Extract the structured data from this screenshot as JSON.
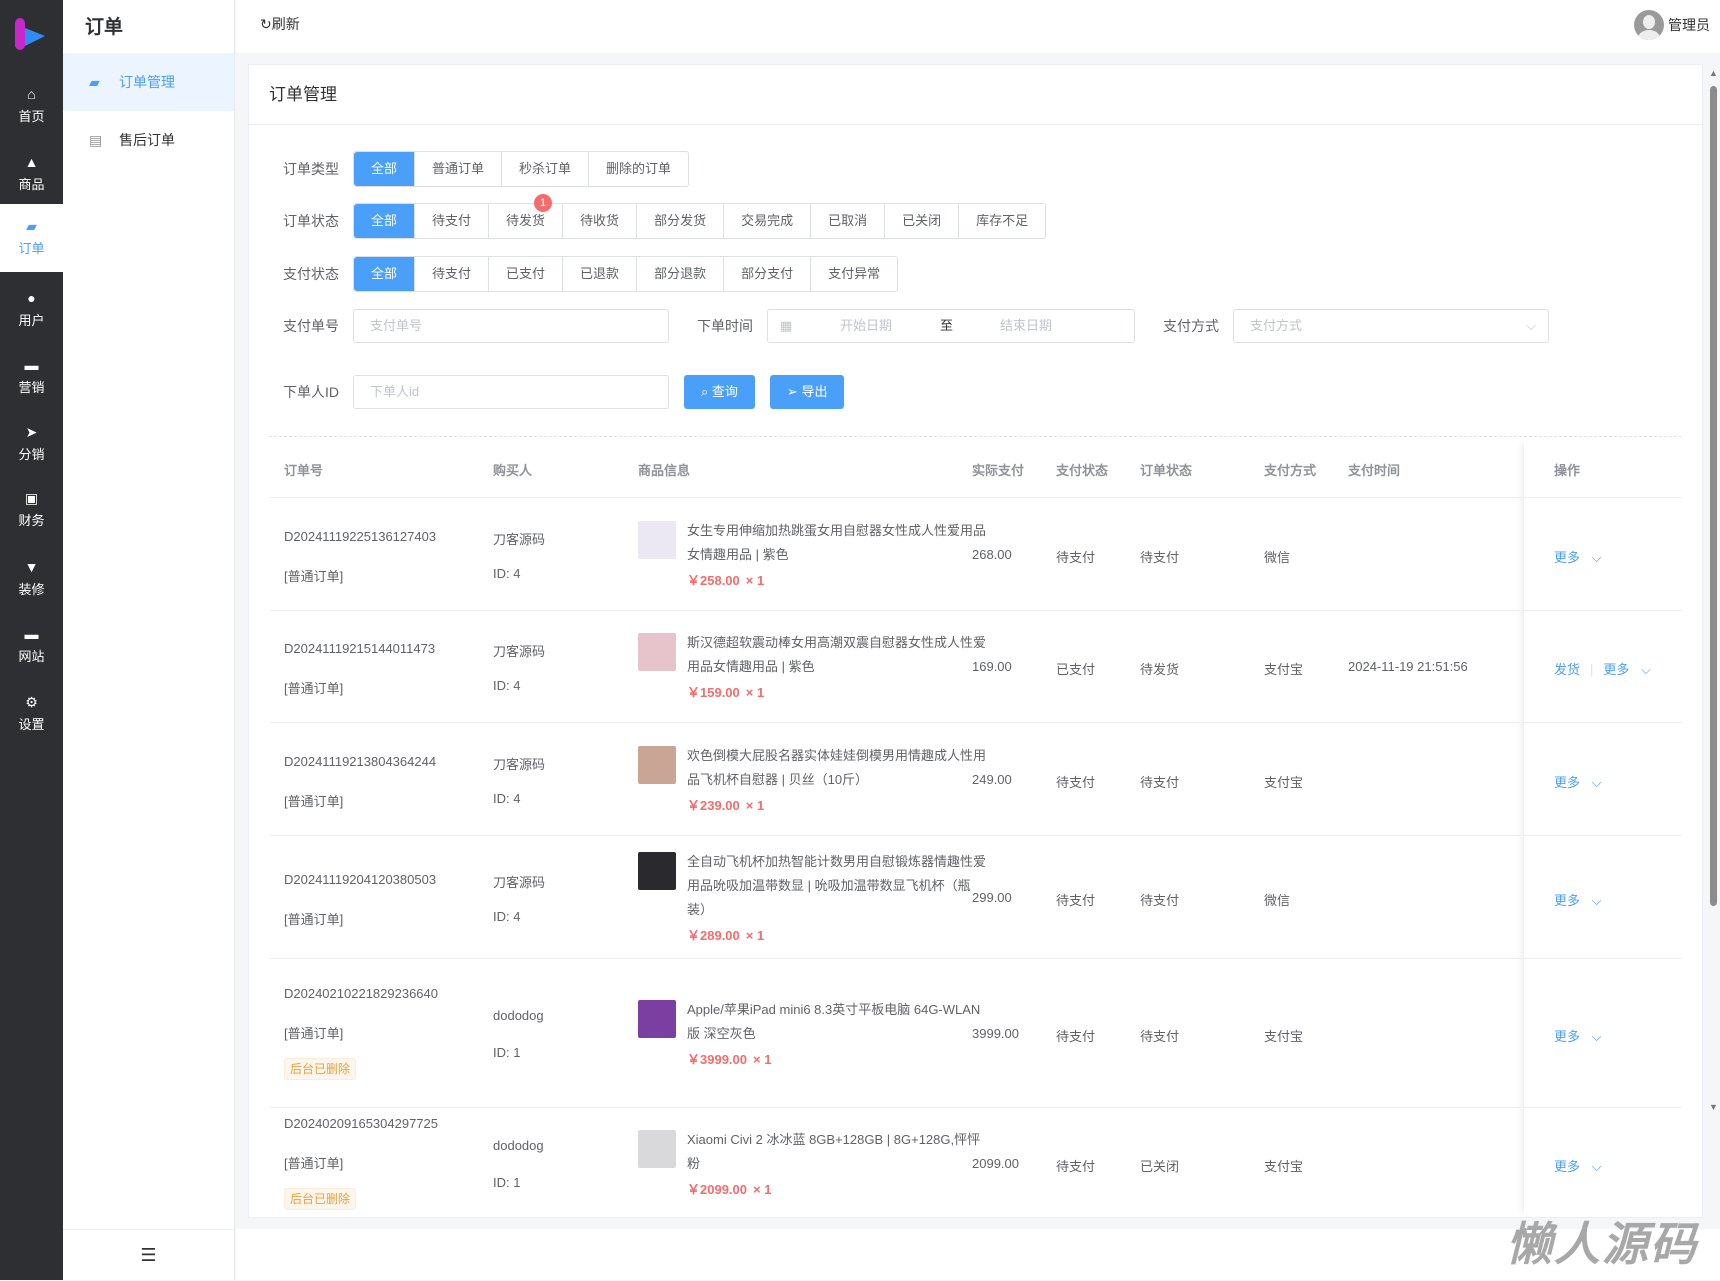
{
  "rail": {
    "items": [
      {
        "label": "首页",
        "icon": "home-icon",
        "glyph": "⌂"
      },
      {
        "label": "商品",
        "icon": "bag-icon",
        "glyph": "▲"
      },
      {
        "label": "订单",
        "icon": "wallet-icon",
        "glyph": "▰"
      },
      {
        "label": "用户",
        "icon": "user-icon",
        "glyph": "●"
      },
      {
        "label": "营销",
        "icon": "ticket-icon",
        "glyph": "▬"
      },
      {
        "label": "分销",
        "icon": "send-icon",
        "glyph": "➤"
      },
      {
        "label": "财务",
        "icon": "money-icon",
        "glyph": "▣"
      },
      {
        "label": "装修",
        "icon": "brush-icon",
        "glyph": "▼"
      },
      {
        "label": "网站",
        "icon": "monitor-icon",
        "glyph": "▬"
      },
      {
        "label": "设置",
        "icon": "gear-icon",
        "glyph": "⚙"
      }
    ],
    "active": 2
  },
  "submenu": {
    "title": "订单",
    "items": [
      {
        "label": "订单管理"
      },
      {
        "label": "售后订单"
      }
    ]
  },
  "topbar": {
    "refresh": "↻刷新",
    "user": "管理员"
  },
  "card": {
    "title": "订单管理"
  },
  "filters": {
    "order_type": {
      "label": "订单类型",
      "options": [
        "全部",
        "普通订单",
        "秒杀订单",
        "删除的订单"
      ]
    },
    "order_status": {
      "label": "订单状态",
      "options": [
        "全部",
        "待支付",
        "待发货",
        "待收货",
        "部分发货",
        "交易完成",
        "已取消",
        "已关闭",
        "库存不足"
      ],
      "badge": "1"
    },
    "pay_status": {
      "label": "支付状态",
      "options": [
        "全部",
        "待支付",
        "已支付",
        "已退款",
        "部分退款",
        "部分支付",
        "支付异常"
      ]
    },
    "pay_no": {
      "label": "支付单号",
      "placeholder": "支付单号"
    },
    "order_time": {
      "label": "下单时间",
      "start": "开始日期",
      "sep": "至",
      "end": "结束日期"
    },
    "pay_method": {
      "label": "支付方式",
      "placeholder": "支付方式"
    },
    "buyer_id": {
      "label": "下单人ID",
      "placeholder": "下单人id"
    },
    "search": "查询",
    "export": "导出"
  },
  "table": {
    "headers": [
      "订单号",
      "购买人",
      "商品信息",
      "实际支付",
      "支付状态",
      "订单状态",
      "支付方式",
      "支付时间",
      "操作"
    ],
    "rows": [
      {
        "order_no": "D20241119225136127403",
        "type": "[普通订单]",
        "buyer": "刀客源码",
        "buyer_id": "ID: 4",
        "product": "女生专用伸缩加热跳蛋女用自慰器女性成人性爱用品女情趣用品 | 紫色",
        "price": "￥258.00",
        "qty": "× 1",
        "paid": "268.00",
        "pay_status": "待支付",
        "order_status": "待支付",
        "pay_method": "微信",
        "pay_time": "",
        "actions": [
          "更多"
        ],
        "img": "#ece8f3"
      },
      {
        "order_no": "D20241119215144011473",
        "type": "[普通订单]",
        "buyer": "刀客源码",
        "buyer_id": "ID: 4",
        "product": "斯汉德超软震动棒女用高潮双震自慰器女性成人性爱用品女情趣用品 | 紫色",
        "price": "￥159.00",
        "qty": "× 1",
        "paid": "169.00",
        "pay_status": "已支付",
        "order_status": "待发货",
        "pay_method": "支付宝",
        "pay_time": "2024-11-19 21:51:56",
        "actions": [
          "发货",
          "更多"
        ],
        "img": "#e7c3cc"
      },
      {
        "order_no": "D20241119213804364244",
        "type": "[普通订单]",
        "buyer": "刀客源码",
        "buyer_id": "ID: 4",
        "product": "欢色倒模大屁股名器实体娃娃倒模男用情趣成人性用品飞机杯自慰器 | 贝丝（10斤）",
        "price": "￥239.00",
        "qty": "× 1",
        "paid": "249.00",
        "pay_status": "待支付",
        "order_status": "待支付",
        "pay_method": "支付宝",
        "pay_time": "",
        "actions": [
          "更多"
        ],
        "img": "#c9a596"
      },
      {
        "order_no": "D20241119204120380503",
        "type": "[普通订单]",
        "buyer": "刀客源码",
        "buyer_id": "ID: 4",
        "product": "全自动飞机杯加热智能计数男用自慰锻炼器情趣性爱用品吮吸加温带数显 | 吮吸加温带数显飞机杯（瓶装）",
        "price": "￥289.00",
        "qty": "× 1",
        "paid": "299.00",
        "pay_status": "待支付",
        "order_status": "待支付",
        "pay_method": "微信",
        "pay_time": "",
        "actions": [
          "更多"
        ],
        "img": "#2a2a2e"
      },
      {
        "order_no": "D20240210221829236640",
        "type": "[普通订单]",
        "tag": "后台已删除",
        "buyer": "dododog",
        "buyer_id": "ID: 1",
        "product": "Apple/苹果iPad mini6 8.3英寸平板电脑 64G-WLAN版 深空灰色",
        "price": "￥3999.00",
        "qty": "× 1",
        "paid": "3999.00",
        "pay_status": "待支付",
        "order_status": "待支付",
        "pay_method": "支付宝",
        "pay_time": "",
        "actions": [
          "更多"
        ],
        "img": "#7a3fa0"
      },
      {
        "order_no": "D20240209165304297725",
        "type": "[普通订单]",
        "tag": "后台已删除",
        "buyer": "dododog",
        "buyer_id": "ID: 1",
        "product": "Xiaomi Civi 2 冰冰蓝 8GB+128GB | 8G+128G,怦怦粉",
        "price": "￥2099.00",
        "qty": "× 1",
        "paid": "2099.00",
        "pay_status": "待支付",
        "order_status": "已关闭",
        "pay_method": "支付宝",
        "pay_time": "",
        "actions": [
          "更多"
        ],
        "img": "#d9d9dc"
      }
    ]
  },
  "watermark": "懒人源码",
  "colors": {
    "primary": "#4a9ff9",
    "rail": "#2e2f32",
    "price": "#f56c6c",
    "warning": "#e6a23c"
  }
}
